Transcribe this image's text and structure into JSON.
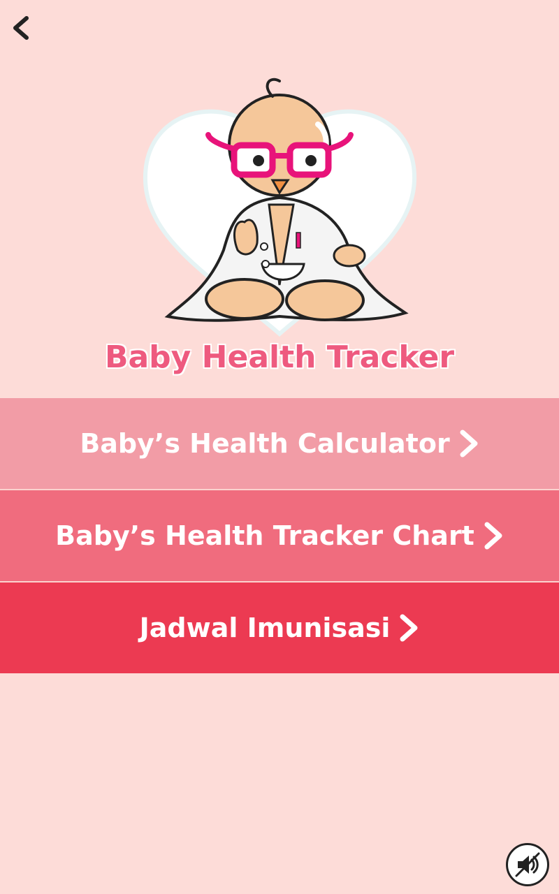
{
  "header": {
    "back_icon": "chevron-left-icon"
  },
  "hero": {
    "illustration": "baby-doctor-with-heart"
  },
  "app": {
    "title": "Baby Health Tracker"
  },
  "menu": {
    "items": [
      {
        "label": "Baby’s Health Calculator",
        "color": "#f29ca6",
        "icon": "chevron-right-icon"
      },
      {
        "label": "Baby’s Health Tracker Chart",
        "color": "#f06c7e",
        "icon": "chevron-right-icon"
      },
      {
        "label": "Jadwal Imunisasi",
        "color": "#ec3a52",
        "icon": "chevron-right-icon"
      }
    ]
  },
  "footer": {
    "sound_icon": "speaker-muted-icon"
  },
  "colors": {
    "background": "#fddcd8",
    "title": "#ee5a7f",
    "accent_glasses": "#e8137a"
  }
}
